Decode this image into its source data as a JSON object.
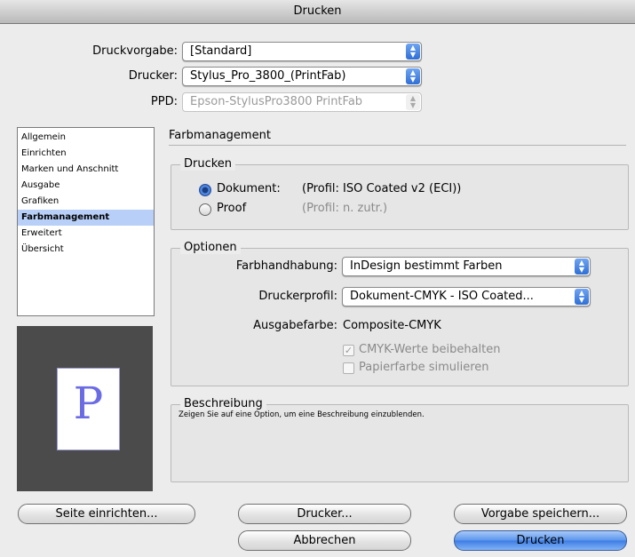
{
  "window": {
    "title": "Drucken"
  },
  "top": {
    "druckvorgabe_label": "Druckvorgabe:",
    "druckvorgabe_value": "[Standard]",
    "drucker_label": "Drucker:",
    "drucker_value": "Stylus_Pro_3800_(PrintFab)",
    "ppd_label": "PPD:",
    "ppd_value": "Epson-StylusPro3800 PrintFab"
  },
  "sidebar": {
    "items": [
      {
        "label": "Allgemein"
      },
      {
        "label": "Einrichten"
      },
      {
        "label": "Marken und Anschnitt"
      },
      {
        "label": "Ausgabe"
      },
      {
        "label": "Grafiken"
      },
      {
        "label": "Farbmanagement",
        "selected": true
      },
      {
        "label": "Erweitert"
      },
      {
        "label": "Übersicht"
      }
    ]
  },
  "preview": {
    "letter": "P"
  },
  "main": {
    "section_title": "Farbmanagement",
    "drucken_group": {
      "title": "Drucken",
      "dokument_label": "Dokument:",
      "dokument_profile": "(Profil: ISO Coated v2 (ECI))",
      "proof_label": "Proof",
      "proof_profile": "(Profil: n. zutr.)"
    },
    "optionen_group": {
      "title": "Optionen",
      "farbhandhabung_label": "Farbhandhabung:",
      "farbhandhabung_value": "InDesign bestimmt Farben",
      "druckerprofil_label": "Druckerprofil:",
      "druckerprofil_value": "Dokument-CMYK - ISO Coated...",
      "ausgabefarbe_label": "Ausgabefarbe:",
      "ausgabefarbe_value": "Composite-CMYK",
      "cmyk_label": "CMYK-Werte beibehalten",
      "papier_label": "Papierfarbe simulieren"
    },
    "beschreibung_group": {
      "title": "Beschreibung",
      "text": "Zeigen Sie auf eine Option, um eine Beschreibung einzublenden."
    }
  },
  "buttons": {
    "seite_einrichten": "Seite einrichten...",
    "drucker": "Drucker...",
    "vorgabe_speichern": "Vorgabe speichern...",
    "abbrechen": "Abbrechen",
    "drucken": "Drucken"
  },
  "icons": {
    "popup": "up-down-arrows-icon",
    "radio": "radio-button-icon",
    "checkbox": "checkbox-icon"
  }
}
